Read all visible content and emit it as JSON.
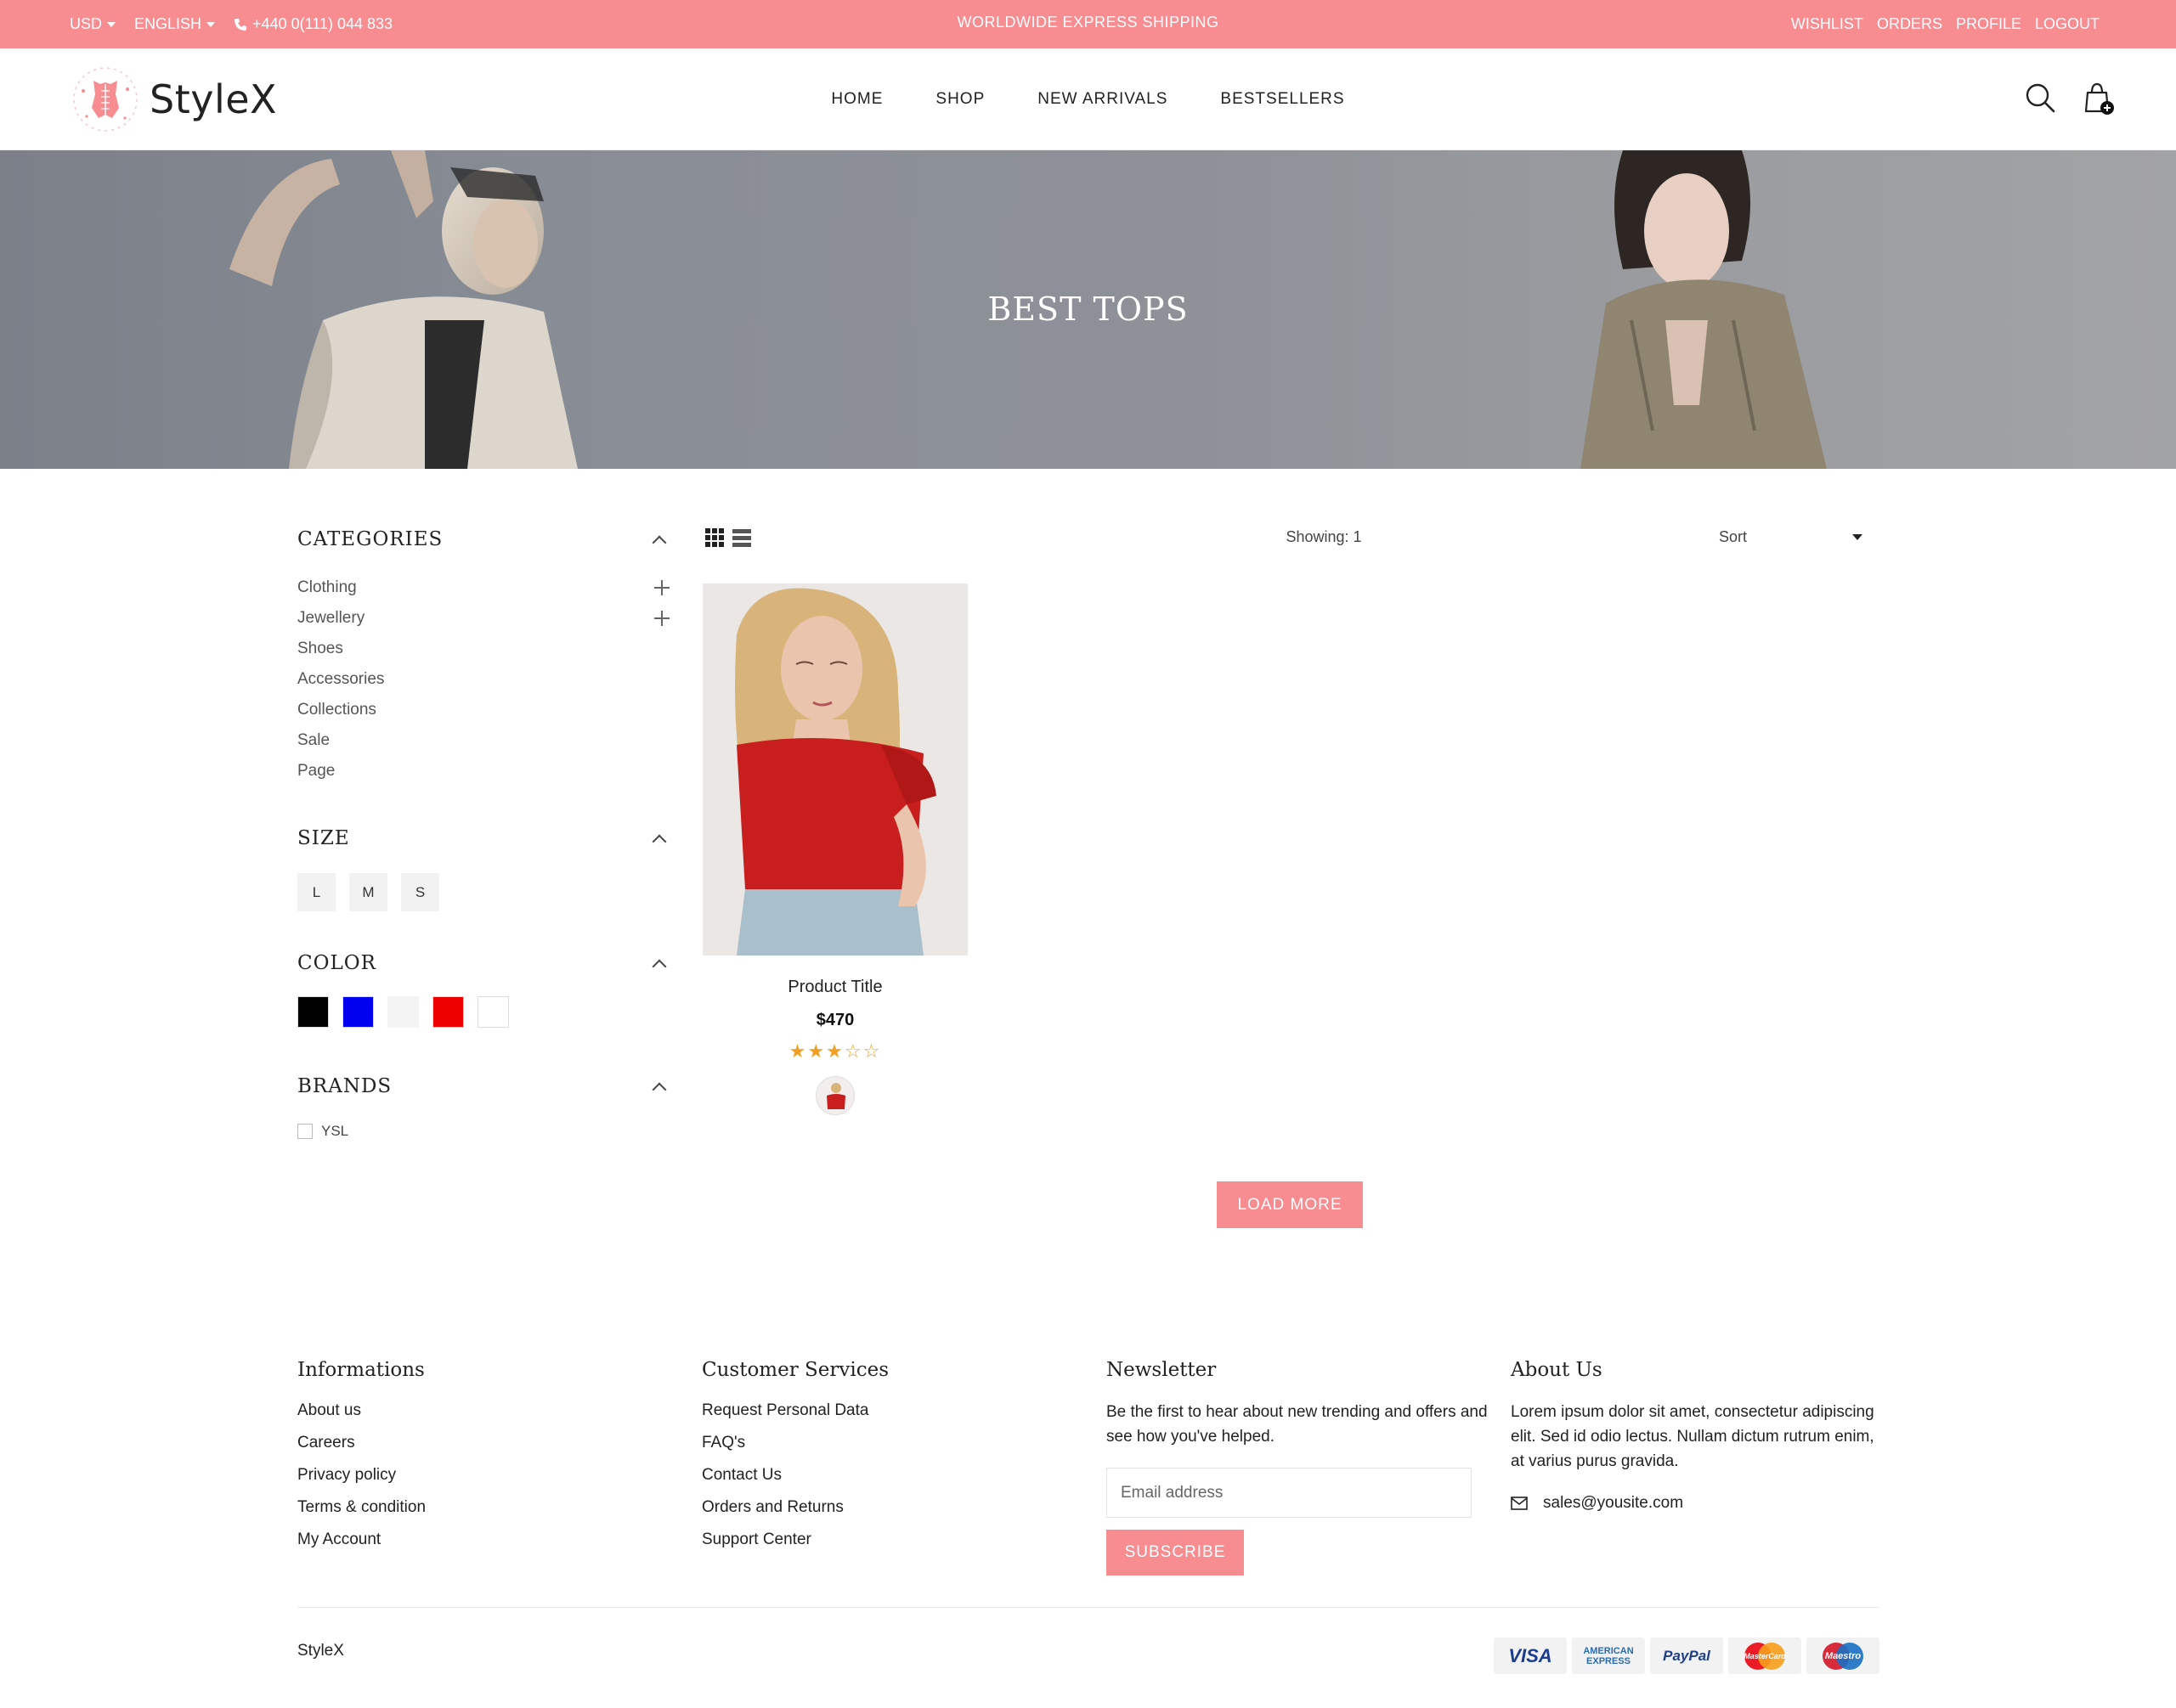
{
  "colors": {
    "accent": "#f78c91",
    "text": "#222222"
  },
  "topbar": {
    "currency": "USD",
    "language": "ENGLISH",
    "phone": "+440 0(111) 044 833",
    "shipping": "WORLDWIDE EXPRESS SHIPPING",
    "links": [
      "WISHLIST",
      "ORDERS",
      "PROFILE",
      "LOGOUT"
    ]
  },
  "header": {
    "brand": "StyleX",
    "nav": [
      "HOME",
      "SHOP",
      "NEW ARRIVALS",
      "BESTSELLERS"
    ]
  },
  "banner": {
    "title": "BEST TOPS"
  },
  "filters": {
    "categories": {
      "title": "CATEGORIES",
      "items": [
        {
          "label": "Clothing",
          "expandable": true
        },
        {
          "label": "Jewellery",
          "expandable": true
        },
        {
          "label": "Shoes",
          "expandable": false
        },
        {
          "label": "Accessories",
          "expandable": false
        },
        {
          "label": "Collections",
          "expandable": false
        },
        {
          "label": "Sale",
          "expandable": false
        },
        {
          "label": "Page",
          "expandable": false
        }
      ]
    },
    "size": {
      "title": "SIZE",
      "options": [
        "L",
        "M",
        "S"
      ]
    },
    "color": {
      "title": "COLOR",
      "swatches": [
        "#000000",
        "#0000ee",
        "#f4f4f4",
        "#ee0000",
        "#ffffff"
      ]
    },
    "brands": {
      "title": "BRANDS",
      "items": [
        "YSL"
      ]
    }
  },
  "toolbar": {
    "showing": "Showing: 1",
    "sort": "Sort"
  },
  "products": [
    {
      "title": "Product Title",
      "price": "$470",
      "rating": 3,
      "rating_max": 5
    }
  ],
  "load_more": "LOAD MORE",
  "footer": {
    "informations": {
      "title": "Informations",
      "links": [
        "About us",
        "Careers",
        "Privacy policy",
        "Terms & condition",
        "My Account"
      ]
    },
    "customer_services": {
      "title": "Customer Services",
      "links": [
        "Request Personal Data",
        "FAQ's",
        "Contact Us",
        "Orders and Returns",
        "Support Center"
      ]
    },
    "newsletter": {
      "title": "Newsletter",
      "text": "Be the first to hear about new trending and offers and see how you've helped.",
      "placeholder": "Email address",
      "button": "SUBSCRIBE"
    },
    "about": {
      "title": "About Us",
      "text": "Lorem ipsum dolor sit amet, consectetur adipiscing elit. Sed id odio lectus. Nullam dictum rutrum enim, at varius purus gravida.",
      "email": "sales@yousite.com"
    },
    "copyright": "StyleX",
    "payments": [
      "VISA",
      "AMERICAN EXPRESS",
      "PayPal",
      "MasterCard",
      "Maestro"
    ]
  }
}
